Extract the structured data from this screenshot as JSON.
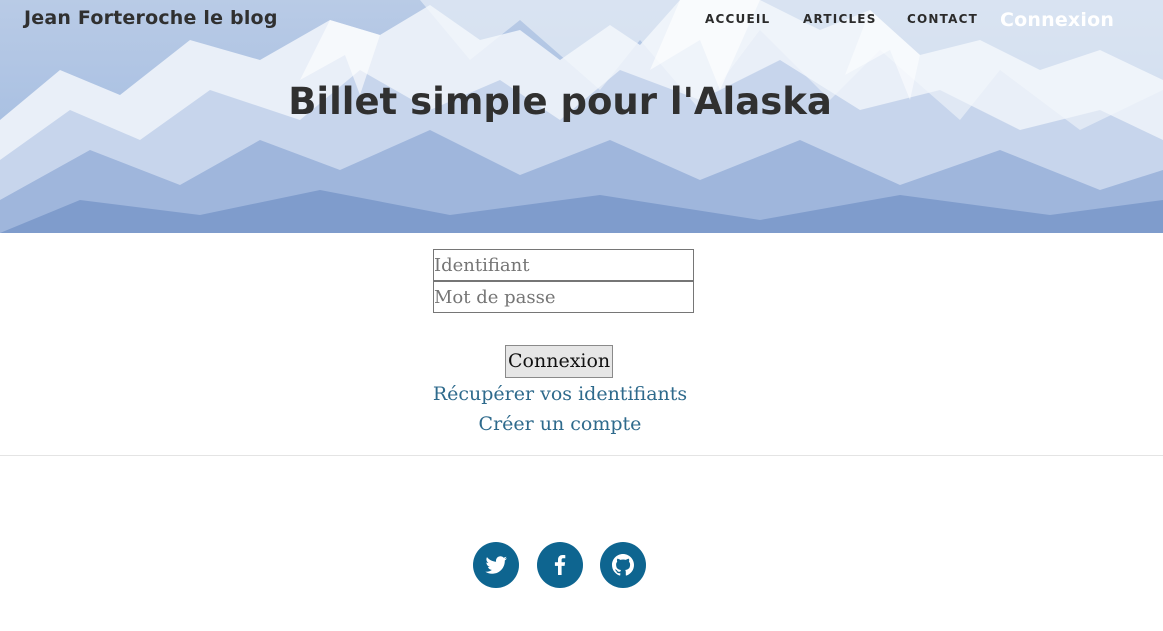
{
  "header": {
    "brand": "Jean Forteroche le blog",
    "nav": [
      {
        "label": "ACCUEIL"
      },
      {
        "label": "ARTICLES"
      },
      {
        "label": "CONTACT"
      },
      {
        "label": "Connexion"
      }
    ],
    "title": "Billet simple pour l'Alaska"
  },
  "login_form": {
    "username_placeholder": "Identifiant",
    "username_value": "",
    "password_placeholder": "Mot de passe",
    "password_value": "",
    "submit_label": "Connexion",
    "recover_link": "Récupérer vos identifiants",
    "create_link": "Créer un compte"
  },
  "footer": {
    "social": [
      {
        "icon": "twitter-icon"
      },
      {
        "icon": "facebook-icon"
      },
      {
        "icon": "github-icon"
      }
    ]
  },
  "colors": {
    "link": "#2e6a8c",
    "social_bg": "#0e6590",
    "heading": "#303030"
  }
}
